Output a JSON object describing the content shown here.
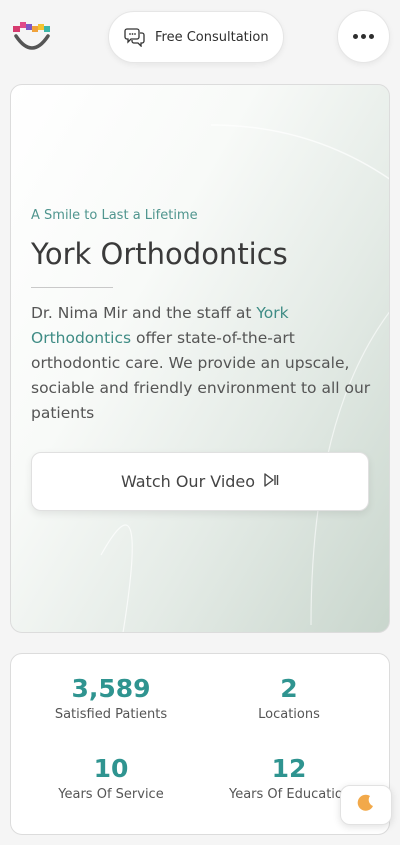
{
  "header": {
    "consult_label": "Free Consultation"
  },
  "hero": {
    "tagline": "A Smile to Last a Lifetime",
    "title": "York Orthodontics",
    "desc_prefix": "Dr. Nima Mir and the staff at ",
    "desc_link": "York Orthodontics",
    "desc_suffix": " offer state-of-the-art orthodontic care. We provide an upscale, sociable and friendly environment to all our patients",
    "video_label": "Watch Our Video"
  },
  "stats": [
    {
      "value": "3,589",
      "label": "Satisfied Patients"
    },
    {
      "value": "2",
      "label": "Locations"
    },
    {
      "value": "10",
      "label": "Years Of Service"
    },
    {
      "value": "12",
      "label": "Years Of Education"
    }
  ],
  "colors": {
    "accent": "#2f9490",
    "link": "#3f8c85",
    "tagline": "#4f958e"
  },
  "icons": [
    "logo",
    "chat-icon",
    "more-dots-icon",
    "play-pause-icon",
    "moon-icon"
  ]
}
